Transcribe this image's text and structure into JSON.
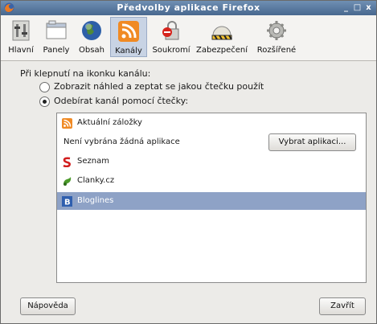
{
  "window": {
    "title": "Předvolby aplikace Firefox",
    "controls": [
      "_",
      "□",
      "x"
    ]
  },
  "toolbar": {
    "panes": [
      {
        "label": "Hlavní",
        "icon": "general-switches-icon"
      },
      {
        "label": "Panely",
        "icon": "tabs-window-icon"
      },
      {
        "label": "Obsah",
        "icon": "globe-icon"
      },
      {
        "label": "Kanály",
        "icon": "rss-feed-icon",
        "selected": true
      },
      {
        "label": "Soukromí",
        "icon": "privacy-lock-icon"
      },
      {
        "label": "Zabezpečení",
        "icon": "security-hardhat-icon"
      },
      {
        "label": "Rozšířené",
        "icon": "gear-icon"
      }
    ]
  },
  "feeds": {
    "heading": "Při klepnutí na ikonku kanálu:",
    "option_preview": {
      "label": "Zobrazit náhled a zeptat se jakou čtečku použít",
      "checked": false
    },
    "option_subscribe": {
      "label": "Odebírat kanál pomocí čtečky:",
      "checked": true
    },
    "readers": [
      {
        "label": "Aktuální záložky",
        "icon": "rss-feed-icon"
      },
      {
        "label": "Není vybrána žádná aplikace",
        "icon": ""
      },
      {
        "label": "Seznam",
        "icon": "seznam-icon"
      },
      {
        "label": "Clanky.cz",
        "icon": "clanky-icon"
      },
      {
        "label": "Bloglines",
        "icon": "bloglines-icon",
        "selected": true
      }
    ],
    "choose_app_button": "Vybrat aplikaci..."
  },
  "footer": {
    "help_button": "Nápověda",
    "close_button": "Zavřít"
  }
}
